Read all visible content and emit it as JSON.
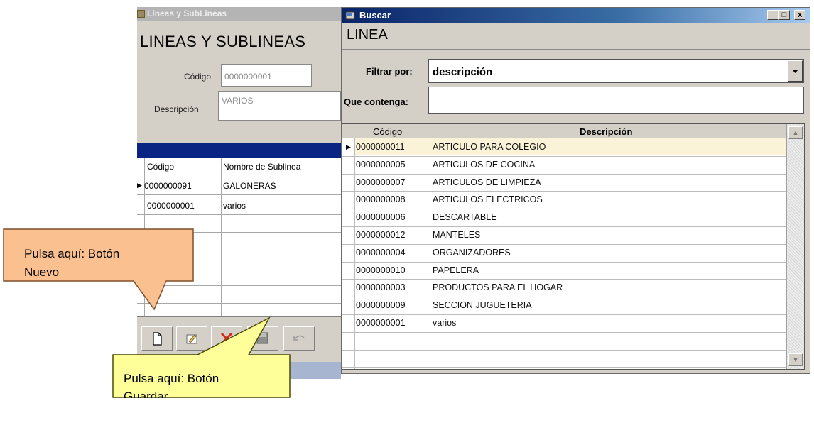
{
  "window_lineas": {
    "title": "Lineas y SubLineas",
    "heading": "LINEAS Y SUBLINEAS",
    "codigo_label": "Código",
    "codigo_value": "0000000001",
    "descripcion_label": "Descripción",
    "descripcion_value": "VARIOS",
    "grid": {
      "headers": [
        "Código",
        "Nombre de Sublinea"
      ],
      "rows": [
        {
          "codigo": "0000000091",
          "nombre": "GALONERAS"
        },
        {
          "codigo": "0000000001",
          "nombre": "varios"
        }
      ]
    },
    "toolbar": [
      "new-icon",
      "edit-icon",
      "delete-icon",
      "save-icon",
      "undo-icon"
    ]
  },
  "window_buscar": {
    "title": "Buscar",
    "heading": "LINEA",
    "window_buttons": [
      "_",
      "□",
      "x"
    ],
    "filter_label": "Filtrar por:",
    "filter_value": "descripción",
    "contains_label": "Que contenga:",
    "contains_value": "",
    "grid": {
      "headers": [
        "Código",
        "Descripción"
      ],
      "rows": [
        {
          "codigo": "0000000011",
          "descripcion": "ARTICULO PARA COLEGIO"
        },
        {
          "codigo": "0000000005",
          "descripcion": "ARTICULOS DE COCINA"
        },
        {
          "codigo": "0000000007",
          "descripcion": "ARTICULOS DE LIMPIEZA"
        },
        {
          "codigo": "0000000008",
          "descripcion": "ARTICULOS ELECTRICOS"
        },
        {
          "codigo": "0000000006",
          "descripcion": "DESCARTABLE"
        },
        {
          "codigo": "0000000012",
          "descripcion": "MANTELES"
        },
        {
          "codigo": "0000000004",
          "descripcion": "ORGANIZADORES"
        },
        {
          "codigo": "0000000010",
          "descripcion": "PAPELERA"
        },
        {
          "codigo": "0000000003",
          "descripcion": "PRODUCTOS PARA EL HOGAR"
        },
        {
          "codigo": "0000000009",
          "descripcion": "SECCION JUGUETERIA"
        },
        {
          "codigo": "0000000001",
          "descripcion": "varios"
        }
      ]
    }
  },
  "callouts": {
    "nuevo": {
      "line1": "Pulsa aquí: Botón",
      "line2": "Nuevo",
      "color": "#fac090"
    },
    "guardar": {
      "line1": "Pulsa aquí: Botón",
      "line2": "Guardar",
      "color": "#ffff99"
    }
  }
}
